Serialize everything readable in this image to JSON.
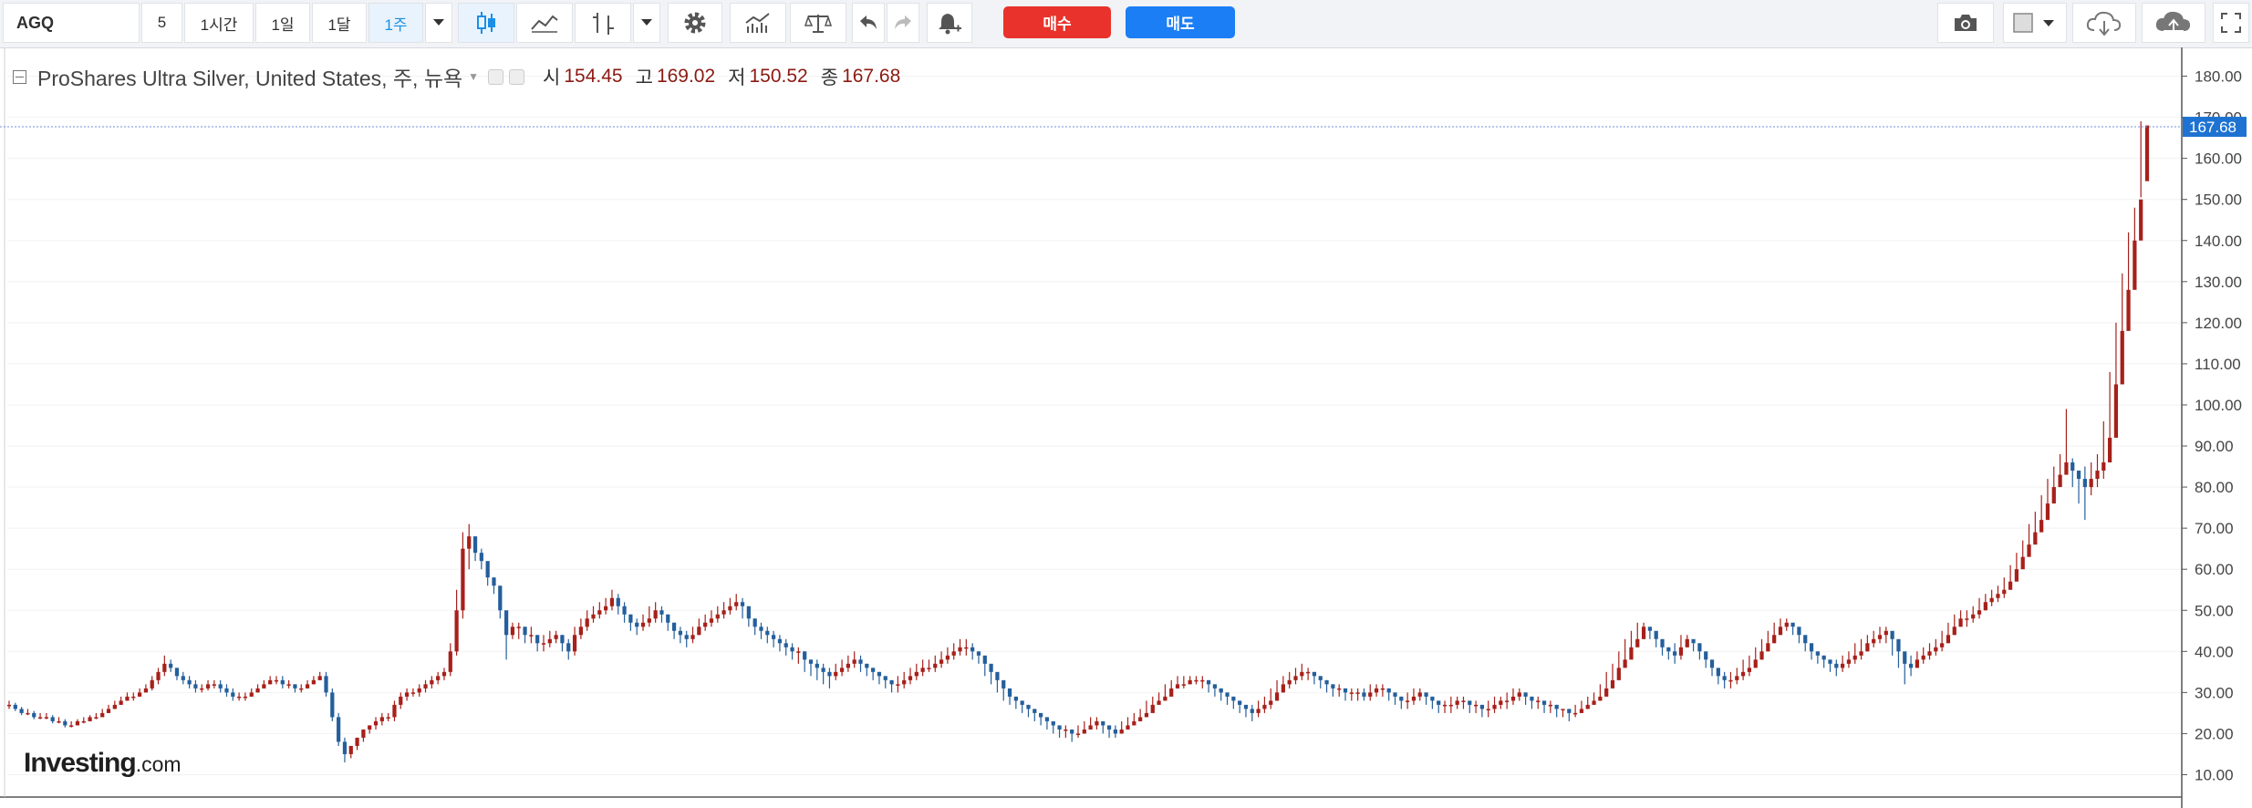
{
  "toolbar": {
    "symbol": "AGQ",
    "intervals": [
      "5",
      "1시간",
      "1일",
      "1달",
      "1주"
    ],
    "active_interval": "1주",
    "buy_label": "매수",
    "sell_label": "매도"
  },
  "legend": {
    "title": "ProShares Ultra Silver, United States, 주, 뉴욕",
    "open_label": "시",
    "open": "154.45",
    "high_label": "고",
    "high": "169.02",
    "low_label": "저",
    "low": "150.52",
    "close_label": "종",
    "close": "167.68"
  },
  "logo": {
    "main": "Investing",
    "suffix": ".com"
  },
  "colors": {
    "up": "#a7201a",
    "down": "#245f9c",
    "last_price_tag": "#1e73d2",
    "axis": "#555555",
    "grid": "#f2f2f2"
  },
  "chart_data": {
    "type": "candlestick",
    "ylim": [
      5,
      187
    ],
    "yticks": [
      "10.00",
      "20.00",
      "30.00",
      "40.00",
      "50.00",
      "60.00",
      "70.00",
      "80.00",
      "90.00",
      "100.00",
      "110.00",
      "120.00",
      "130.00",
      "140.00",
      "150.00",
      "160.00",
      "170.00",
      "180.00"
    ],
    "last_price": "167.68",
    "close": [
      27,
      26,
      25,
      25,
      24,
      24,
      24,
      23,
      23,
      22,
      22,
      23,
      23,
      24,
      24,
      25,
      26,
      27,
      28,
      29,
      29,
      30,
      31,
      33,
      35,
      37,
      36,
      34,
      33,
      32,
      31,
      31,
      32,
      32,
      31,
      30,
      29,
      29,
      29,
      30,
      31,
      32,
      33,
      33,
      32,
      32,
      31,
      31,
      32,
      33,
      34,
      30,
      24,
      18,
      15,
      17,
      19,
      21,
      22,
      23,
      24,
      24,
      27,
      29,
      30,
      30,
      31,
      32,
      33,
      34,
      35,
      40,
      50,
      65,
      68,
      64,
      62,
      58,
      56,
      50,
      44,
      46,
      46,
      44,
      44,
      42,
      42,
      43,
      44,
      42,
      40,
      44,
      46,
      48,
      49,
      50,
      51,
      53,
      51,
      49,
      47,
      46,
      47,
      48,
      50,
      49,
      47,
      45,
      44,
      43,
      44,
      46,
      47,
      48,
      49,
      50,
      51,
      52,
      51,
      48,
      46,
      45,
      44,
      43,
      42,
      41,
      40,
      40,
      38,
      37,
      36,
      35,
      34,
      35,
      36,
      37,
      38,
      37,
      36,
      35,
      34,
      33,
      32,
      32,
      33,
      34,
      35,
      36,
      36,
      37,
      38,
      39,
      40,
      41,
      41,
      40,
      39,
      37,
      35,
      33,
      31,
      29,
      28,
      27,
      26,
      25,
      24,
      23,
      22,
      21,
      21,
      20,
      20,
      21,
      22,
      23,
      22,
      21,
      20,
      21,
      22,
      23,
      24,
      25,
      27,
      28,
      29,
      31,
      32,
      32,
      33,
      33,
      33,
      32,
      31,
      30,
      29,
      28,
      27,
      26,
      25,
      26,
      27,
      28,
      30,
      32,
      33,
      34,
      35,
      35,
      34,
      33,
      32,
      31,
      31,
      30,
      30,
      30,
      29,
      30,
      31,
      31,
      30,
      29,
      28,
      28,
      29,
      30,
      29,
      28,
      27,
      27,
      27,
      28,
      28,
      27,
      27,
      26,
      26,
      27,
      28,
      28,
      29,
      30,
      29,
      28,
      28,
      27,
      27,
      26,
      26,
      25,
      25,
      26,
      27,
      28,
      29,
      31,
      33,
      36,
      38,
      41,
      43,
      46,
      45,
      43,
      41,
      40,
      39,
      41,
      43,
      42,
      40,
      38,
      36,
      34,
      33,
      33,
      34,
      35,
      36,
      38,
      40,
      42,
      44,
      46,
      47,
      46,
      44,
      42,
      40,
      39,
      38,
      37,
      36,
      37,
      38,
      39,
      40,
      42,
      43,
      44,
      45,
      43,
      40,
      37,
      36,
      38,
      39,
      40,
      41,
      42,
      44,
      46,
      48,
      48,
      49,
      50,
      52,
      53,
      54,
      55,
      57,
      60,
      63,
      66,
      69,
      72,
      76,
      80,
      83,
      86,
      84,
      82,
      80,
      82,
      84,
      86,
      92,
      105,
      118,
      128,
      140,
      150,
      168
    ],
    "open": [
      27,
      27,
      26,
      25,
      25,
      24,
      24,
      24,
      23,
      23,
      22,
      22,
      23,
      23,
      24,
      24,
      25,
      26,
      27,
      28,
      29,
      29,
      30,
      31,
      33,
      35,
      37,
      36,
      34,
      33,
      32,
      31,
      31,
      32,
      32,
      31,
      30,
      29,
      29,
      29,
      30,
      31,
      32,
      33,
      33,
      32,
      32,
      31,
      31,
      32,
      33,
      34,
      30,
      24,
      18,
      15,
      17,
      19,
      21,
      22,
      23,
      24,
      24,
      27,
      29,
      30,
      30,
      31,
      32,
      33,
      34,
      35,
      40,
      50,
      65,
      68,
      64,
      62,
      58,
      56,
      50,
      44,
      46,
      46,
      44,
      44,
      42,
      42,
      43,
      44,
      42,
      40,
      44,
      46,
      48,
      49,
      50,
      51,
      53,
      51,
      49,
      47,
      46,
      47,
      48,
      50,
      49,
      47,
      45,
      44,
      43,
      44,
      46,
      47,
      48,
      49,
      50,
      51,
      52,
      51,
      48,
      46,
      45,
      44,
      43,
      42,
      41,
      40,
      40,
      38,
      37,
      36,
      35,
      34,
      35,
      36,
      37,
      38,
      37,
      36,
      35,
      34,
      33,
      32,
      32,
      33,
      34,
      35,
      36,
      36,
      37,
      38,
      39,
      40,
      41,
      41,
      40,
      39,
      37,
      35,
      33,
      31,
      29,
      28,
      27,
      26,
      25,
      24,
      23,
      22,
      21,
      21,
      20,
      20,
      21,
      22,
      23,
      22,
      21,
      20,
      21,
      22,
      23,
      24,
      25,
      27,
      28,
      29,
      31,
      32,
      32,
      33,
      33,
      33,
      32,
      31,
      30,
      29,
      28,
      27,
      26,
      25,
      26,
      27,
      28,
      30,
      32,
      33,
      34,
      35,
      35,
      34,
      33,
      32,
      31,
      31,
      30,
      30,
      30,
      29,
      30,
      31,
      31,
      30,
      29,
      28,
      28,
      29,
      30,
      29,
      28,
      27,
      27,
      27,
      28,
      28,
      27,
      27,
      26,
      26,
      27,
      28,
      28,
      29,
      30,
      29,
      28,
      28,
      27,
      27,
      26,
      26,
      25,
      25,
      26,
      27,
      28,
      29,
      31,
      33,
      36,
      38,
      41,
      43,
      46,
      45,
      43,
      41,
      40,
      39,
      41,
      43,
      42,
      40,
      38,
      36,
      34,
      33,
      33,
      34,
      35,
      36,
      38,
      40,
      42,
      44,
      46,
      47,
      46,
      44,
      42,
      40,
      39,
      38,
      37,
      36,
      37,
      38,
      39,
      40,
      42,
      43,
      44,
      45,
      43,
      40,
      37,
      36,
      38,
      39,
      40,
      41,
      42,
      44,
      46,
      48,
      48,
      49,
      50,
      52,
      53,
      54,
      55,
      57,
      60,
      63,
      66,
      69,
      72,
      76,
      80,
      83,
      86,
      84,
      82,
      80,
      82,
      84,
      86,
      92,
      105,
      118,
      128,
      140,
      154.45
    ],
    "high": [
      28,
      27.5,
      26.5,
      26,
      25.5,
      25,
      25,
      24.5,
      24,
      23.5,
      23,
      23.5,
      24,
      24.5,
      25,
      26,
      27,
      28,
      29,
      30,
      30,
      31,
      32,
      34,
      36,
      39,
      38,
      36,
      35,
      34,
      33,
      32,
      33,
      33,
      33,
      32,
      31,
      30,
      30,
      31,
      32,
      33,
      34,
      34,
      34,
      33,
      32,
      32,
      33,
      34,
      35,
      35,
      31,
      25,
      19,
      17,
      19,
      21,
      22,
      24,
      25,
      25,
      28,
      30,
      31,
      31,
      32,
      33,
      34,
      35,
      36,
      42,
      55,
      69,
      71,
      68,
      65,
      60,
      58,
      52,
      48,
      47,
      47,
      46,
      46,
      44,
      44,
      45,
      45,
      44,
      43,
      46,
      48,
      50,
      51,
      52,
      53,
      55,
      54,
      52,
      49,
      48,
      49,
      51,
      52,
      51,
      49,
      47,
      46,
      45,
      46,
      48,
      49,
      50,
      51,
      52,
      53,
      54,
      53,
      51,
      48,
      47,
      46,
      45,
      44,
      43,
      42,
      41,
      40,
      38,
      38,
      37,
      36,
      37,
      38,
      39,
      40,
      39,
      37,
      36,
      35,
      34,
      33,
      34,
      35,
      36,
      37,
      38,
      38,
      39,
      40,
      41,
      42,
      43,
      43,
      42,
      40,
      38,
      36,
      34,
      32,
      30,
      29,
      28,
      27,
      26,
      25,
      24,
      23,
      22,
      22,
      21,
      22,
      23,
      24,
      24,
      23,
      22,
      22,
      23,
      24,
      25,
      26,
      28,
      29,
      30,
      32,
      33,
      34,
      34,
      34,
      34,
      34,
      33,
      32,
      31,
      30,
      29,
      28,
      27,
      27,
      28,
      29,
      31,
      33,
      34,
      35,
      36,
      37,
      36,
      35,
      34,
      33,
      32,
      32,
      31,
      31,
      31,
      31,
      32,
      32,
      32,
      31,
      30,
      29,
      30,
      31,
      31,
      30,
      29,
      28,
      28,
      29,
      29,
      29,
      28,
      28,
      27,
      28,
      29,
      29,
      30,
      31,
      31,
      30,
      29,
      29,
      28,
      28,
      27,
      26,
      26,
      27,
      28,
      29,
      30,
      32,
      35,
      37,
      40,
      43,
      45,
      47,
      47,
      45,
      43,
      42,
      41,
      42,
      44,
      44,
      42,
      40,
      38,
      36,
      34,
      35,
      35,
      36,
      38,
      39,
      41,
      43,
      45,
      47,
      48,
      48,
      46,
      44,
      42,
      41,
      40,
      39,
      38,
      38,
      39,
      40,
      42,
      43,
      44,
      45,
      46,
      46,
      44,
      41,
      38,
      39,
      40,
      41,
      42,
      43,
      45,
      47,
      49,
      50,
      50,
      51,
      53,
      54,
      55,
      56,
      58,
      61,
      64,
      67,
      71,
      74,
      78,
      82,
      85,
      88,
      99,
      87,
      84,
      85,
      86,
      88,
      96,
      108,
      120,
      132,
      142,
      148,
      169.02
    ],
    "low": [
      26,
      25.5,
      24.5,
      24.5,
      23.5,
      23.5,
      23.5,
      22.5,
      22.5,
      21.5,
      21.5,
      22,
      22.5,
      23,
      23.5,
      24,
      25,
      26,
      27,
      28,
      28,
      29,
      30,
      30.5,
      32,
      34,
      35,
      33,
      32,
      31,
      30,
      30,
      30.5,
      31,
      30,
      29,
      28,
      28,
      28,
      29,
      30,
      31,
      32,
      32,
      31,
      31,
      30,
      30,
      31,
      32,
      33,
      29,
      23,
      17,
      13,
      14,
      16,
      18,
      20,
      21,
      22,
      23,
      23,
      26,
      28,
      29,
      29,
      30,
      31,
      32,
      33,
      34,
      39,
      48,
      60,
      62,
      60,
      56,
      54,
      48,
      38,
      43,
      43,
      42,
      42,
      40,
      40,
      41,
      42,
      40,
      38,
      39,
      43,
      45,
      47,
      48,
      49,
      50,
      49,
      47,
      45,
      44,
      45,
      46,
      47,
      47,
      45,
      43,
      42,
      41,
      42,
      44,
      45,
      46,
      47,
      48,
      49,
      50,
      48,
      46,
      44,
      43,
      42,
      41,
      40,
      39,
      38,
      37,
      35,
      34,
      33,
      32,
      31,
      33,
      34,
      35,
      36,
      35,
      34,
      33,
      32,
      31,
      30,
      30,
      31,
      32,
      33,
      34,
      35,
      35,
      36,
      37,
      38,
      39,
      39,
      38,
      37,
      34,
      32,
      30,
      28,
      27,
      26,
      25,
      24,
      23,
      22,
      21,
      20,
      19,
      19,
      18,
      19,
      20,
      21,
      21,
      20,
      19,
      19,
      20,
      21,
      22,
      23,
      24,
      26,
      27,
      28,
      30,
      31,
      31,
      32,
      32,
      31,
      30,
      29,
      28,
      27,
      26,
      25,
      24,
      23,
      24,
      25,
      26,
      28,
      30,
      31,
      32,
      33,
      33,
      32,
      31,
      30,
      29,
      29,
      28,
      28,
      28,
      28,
      28,
      29,
      29,
      28,
      27,
      26,
      26,
      27,
      28,
      27,
      26,
      25,
      25,
      25,
      26,
      26,
      25,
      25,
      24,
      24,
      25,
      26,
      26,
      27,
      28,
      27,
      26,
      26,
      25,
      25,
      24,
      24,
      23,
      24,
      25,
      26,
      27,
      28,
      30,
      32,
      35,
      37,
      40,
      42,
      43,
      43,
      41,
      39,
      38,
      37,
      38,
      41,
      40,
      38,
      36,
      34,
      32,
      31,
      31,
      32,
      33,
      34,
      36,
      38,
      40,
      42,
      44,
      45,
      44,
      42,
      40,
      38,
      37,
      36,
      35,
      34,
      35,
      36,
      37,
      38,
      40,
      41,
      42,
      42,
      39,
      36,
      32,
      34,
      36,
      37,
      38,
      39,
      40,
      42,
      44,
      46,
      46,
      47,
      48,
      50,
      51,
      52,
      53,
      55,
      58,
      61,
      64,
      67,
      70,
      74,
      78,
      81,
      83,
      80,
      76,
      72,
      78,
      80,
      82,
      88,
      98,
      112,
      122,
      132,
      150.52
    ]
  }
}
